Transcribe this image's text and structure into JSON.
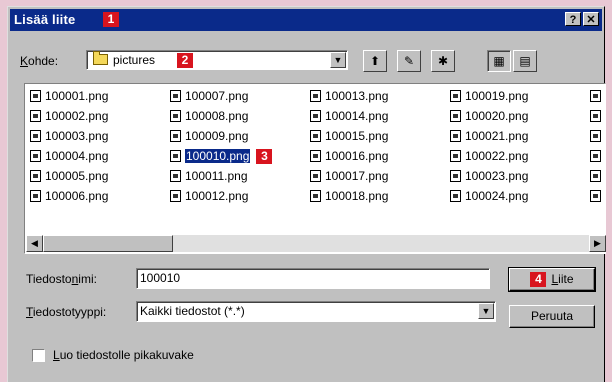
{
  "dialog": {
    "title": "Lisää liite",
    "badges": {
      "title": "1",
      "folder": "2",
      "file": "3",
      "button": "4"
    },
    "help_label": "?",
    "close_label": "✕"
  },
  "location": {
    "label_prefix": "K",
    "label_rest": "ohde:",
    "folder": "pictures",
    "dropdown_arrow": "▼"
  },
  "toolbar": [
    {
      "name": "up-folder-icon",
      "glyph": "⬆"
    },
    {
      "name": "desktop-icon",
      "glyph": "✎"
    },
    {
      "name": "new-folder-icon",
      "glyph": "✱"
    },
    {
      "name": "list-view-icon",
      "glyph": "▦"
    },
    {
      "name": "details-view-icon",
      "glyph": "▤"
    }
  ],
  "files": [
    [
      "100001.png",
      "100002.png",
      "100003.png",
      "100004.png",
      "100005.png",
      "100006.png"
    ],
    [
      "100007.png",
      "100008.png",
      "100009.png",
      "100010.png",
      "100011.png",
      "100012.png"
    ],
    [
      "100013.png",
      "100014.png",
      "100015.png",
      "100016.png",
      "100017.png",
      "100018.png"
    ],
    [
      "100019.png",
      "100020.png",
      "100021.png",
      "100022.png",
      "100023.png",
      "100024.png"
    ]
  ],
  "selected_file": "100010.png",
  "scroll": {
    "left": "◀",
    "right": "▶"
  },
  "filename": {
    "label_a": "Tiedosto",
    "label_u": "n",
    "label_b": "imi:",
    "value": "100010"
  },
  "filetype": {
    "label_u": "T",
    "label_rest": "iedostotyyppi:",
    "value": "Kaikki tiedostot (*.*)",
    "dropdown_arrow": "▼"
  },
  "buttons": {
    "attach_u": "L",
    "attach_rest": "iite",
    "cancel": "Peruuta"
  },
  "shortcut": {
    "label_u": "L",
    "label_rest": "uo tiedostolle pikakuvake",
    "checked": false
  }
}
